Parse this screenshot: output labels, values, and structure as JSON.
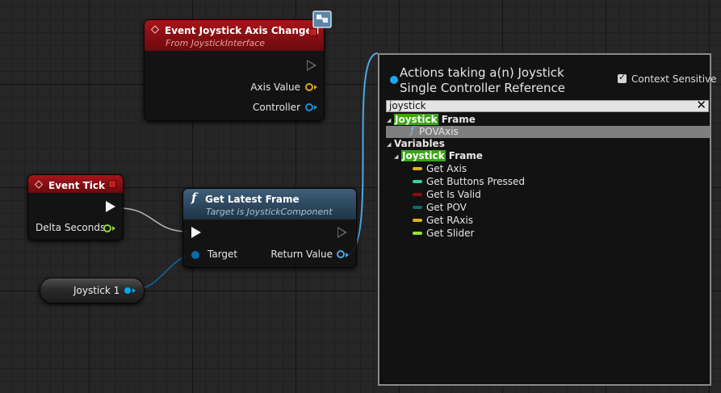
{
  "nodes": {
    "axis_event": {
      "title": "Event Joystick Axis Changed",
      "subtitle": "From JoystickInterface",
      "pins": {
        "axis_value": "Axis Value",
        "controller": "Controller"
      }
    },
    "event_tick": {
      "title": "Event Tick",
      "pins": {
        "delta_seconds": "Delta Seconds"
      }
    },
    "get_latest_frame": {
      "title": "Get Latest Frame",
      "subtitle": "Target is JoystickComponent",
      "pins": {
        "target": "Target",
        "return_value": "Return Value"
      }
    },
    "variable": {
      "label": "Joystick 1"
    }
  },
  "action_panel": {
    "title": "Actions taking a(n) Joystick Single Controller Reference",
    "context_sensitive_label": "Context Sensitive",
    "context_sensitive_checked": true,
    "search_value": "joystick",
    "tree": {
      "category1": {
        "highlight": "Joystick",
        "rest": " Frame",
        "items": [
          {
            "label": "POVAxis",
            "icon": "function-icon"
          }
        ]
      },
      "category2": {
        "label": "Variables",
        "sub": {
          "highlight": "Joystick",
          "rest": " Frame"
        },
        "items": [
          {
            "label": "Get Axis",
            "color": "#e2b21b"
          },
          {
            "label": "Get Buttons Pressed",
            "color": "#2fd3a5"
          },
          {
            "label": "Get Is Valid",
            "color": "#8c0d0d"
          },
          {
            "label": "Get POV",
            "color": "#0b6b6b"
          },
          {
            "label": "Get RAxis",
            "color": "#e2b21b"
          },
          {
            "label": "Get Slider",
            "color": "#9ae23c"
          }
        ]
      }
    }
  }
}
